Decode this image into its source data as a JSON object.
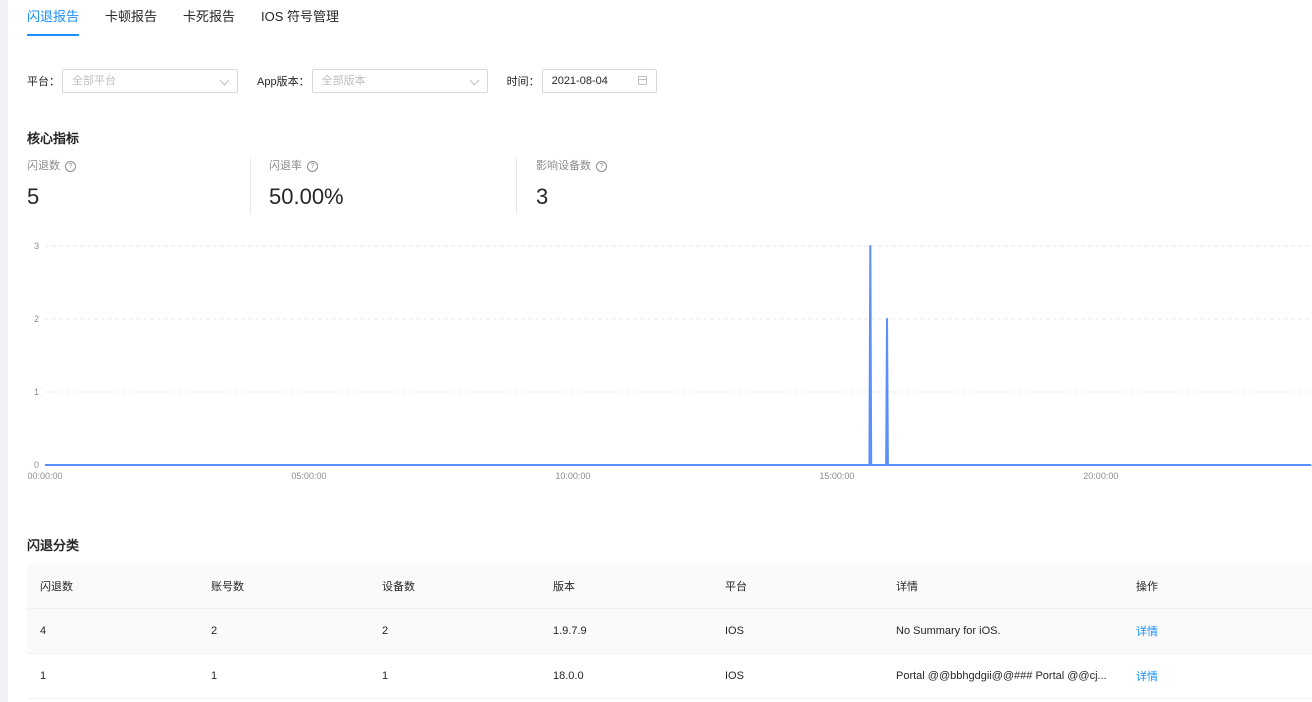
{
  "tabs": [
    "闪退报告",
    "卡顿报告",
    "卡死报告",
    "IOS 符号管理"
  ],
  "active_tab": 0,
  "filters": {
    "platform_label": "平台：",
    "platform_placeholder": "全部平台",
    "version_label": "App版本：",
    "version_placeholder": "全部版本",
    "date_label": "时间：",
    "date_value": "2021-08-04"
  },
  "core": {
    "title": "核心指标",
    "metrics": [
      {
        "label": "闪退数",
        "value": "5"
      },
      {
        "label": "闪退率",
        "value": "50.00%"
      },
      {
        "label": "影响设备数",
        "value": "3"
      }
    ]
  },
  "chart_data": {
    "type": "line",
    "title": "",
    "xlabel": "",
    "ylabel": "",
    "ylim": [
      0,
      3
    ],
    "yticks": [
      0,
      1,
      2,
      3
    ],
    "xticks": [
      "00:00:00",
      "05:00:00",
      "10:00:00",
      "15:00:00",
      "20:00:00"
    ],
    "xlim_hours": [
      0,
      24
    ],
    "grid": true,
    "series": [
      {
        "color": "#5b8ff9",
        "points": [
          {
            "t": "00:00:00",
            "v": 0
          },
          {
            "t": "15:37:00",
            "v": 0
          },
          {
            "t": "15:38:00",
            "v": 3
          },
          {
            "t": "15:39:00",
            "v": 0
          },
          {
            "t": "15:56:00",
            "v": 0
          },
          {
            "t": "15:57:00",
            "v": 2
          },
          {
            "t": "15:58:00",
            "v": 0
          },
          {
            "t": "23:59:00",
            "v": 0
          }
        ]
      }
    ]
  },
  "classify": {
    "title": "闪退分类",
    "columns": [
      "闪退数",
      "账号数",
      "设备数",
      "版本",
      "平台",
      "详情",
      "操作"
    ],
    "rows": [
      {
        "crashes": "4",
        "accounts": "2",
        "devices": "2",
        "version": "1.9.7.9",
        "platform": "IOS",
        "detail": "No Summary for iOS.",
        "action": "详情"
      },
      {
        "crashes": "1",
        "accounts": "1",
        "devices": "1",
        "version": "18.0.0",
        "platform": "IOS",
        "detail": "Portal @@bbhgdgii@@### Portal @@cj...",
        "action": "详情"
      }
    ]
  },
  "colors": {
    "accent": "#1890ff",
    "line": "#5b8ff9"
  }
}
